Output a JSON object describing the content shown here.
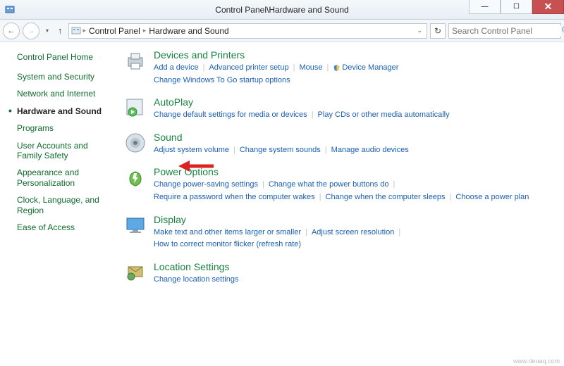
{
  "window": {
    "title": "Control Panel\\Hardware and Sound"
  },
  "breadcrumb": {
    "seg1": "Control Panel",
    "seg2": "Hardware and Sound"
  },
  "search": {
    "placeholder": "Search Control Panel"
  },
  "sidebar": {
    "home": "Control Panel Home",
    "items": [
      "System and Security",
      "Network and Internet",
      "Hardware and Sound",
      "Programs",
      "User Accounts and Family Safety",
      "Appearance and Personalization",
      "Clock, Language, and Region",
      "Ease of Access"
    ]
  },
  "categories": [
    {
      "title": "Devices and Printers",
      "links": [
        "Add a device",
        "Advanced printer setup",
        "Mouse",
        "Device Manager",
        "Change Windows To Go startup options"
      ],
      "shield_at": 3
    },
    {
      "title": "AutoPlay",
      "links": [
        "Change default settings for media or devices",
        "Play CDs or other media automatically"
      ]
    },
    {
      "title": "Sound",
      "links": [
        "Adjust system volume",
        "Change system sounds",
        "Manage audio devices"
      ]
    },
    {
      "title": "Power Options",
      "links": [
        "Change power-saving settings",
        "Change what the power buttons do",
        "Require a password when the computer wakes",
        "Change when the computer sleeps",
        "Choose a power plan"
      ]
    },
    {
      "title": "Display",
      "links": [
        "Make text and other items larger or smaller",
        "Adjust screen resolution",
        "How to correct monitor flicker (refresh rate)"
      ]
    },
    {
      "title": "Location Settings",
      "links": [
        "Change location settings"
      ]
    }
  ],
  "watermark": "www.deuaq.com"
}
